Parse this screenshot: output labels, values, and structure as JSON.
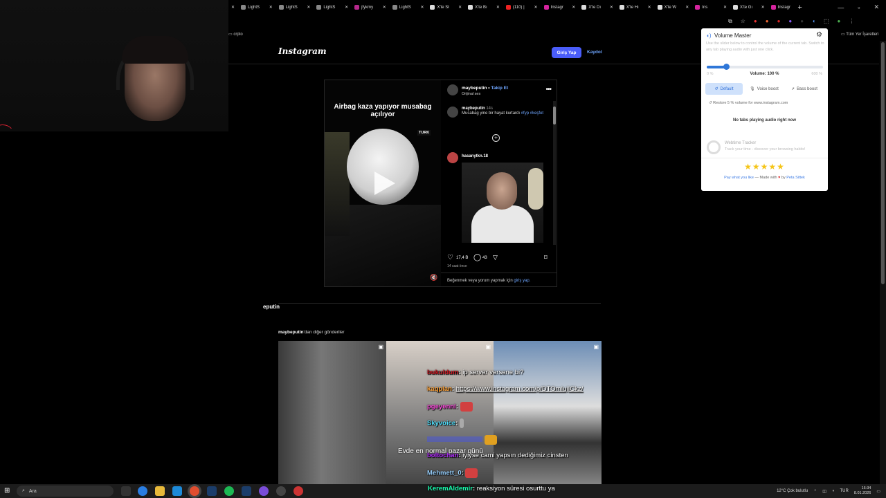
{
  "browser": {
    "tabs": [
      {
        "label": "LightS",
        "color": "#888"
      },
      {
        "label": "LightS",
        "color": "#888"
      },
      {
        "label": "LightS",
        "color": "#888"
      },
      {
        "label": "jfykmy",
        "color": "#b6288c"
      },
      {
        "label": "LightS",
        "color": "#888"
      },
      {
        "label": "X'te Sł",
        "color": "#ddd"
      },
      {
        "label": "X'te Bı",
        "color": "#ddd"
      },
      {
        "label": "(110) |",
        "color": "#e22"
      },
      {
        "label": "Instagr",
        "color": "#d6249f"
      },
      {
        "label": "X'te Dı",
        "color": "#ddd"
      },
      {
        "label": "X'te Hı",
        "color": "#ddd"
      },
      {
        "label": "X'te W",
        "color": "#ddd"
      },
      {
        "label": "Ins",
        "color": "#d6249f"
      },
      {
        "label": "X'te Gı",
        "color": "#ddd"
      },
      {
        "label": "Instagr",
        "color": "#d6249f"
      }
    ],
    "new_tab": "+",
    "bookmark_left": "crpto",
    "bookmark_right": "Tüm Yer İşaretleri"
  },
  "instagram": {
    "logo": "Instagram",
    "login_button": "Giriş Yap",
    "signup_link": "Kaydol",
    "post": {
      "video_caption": "Airbag kaza yapıyor musabag açılıyor",
      "channel_badge": "TURK",
      "author": "maybeputin",
      "follow": "Takip Et",
      "audio": "Orijinal ses",
      "comment1_user": "maybeputin",
      "comment1_time": "14s",
      "comment1_text": "Musabag yine bir hayat kurtardı",
      "comment1_tags": "#fyp #keşfet",
      "comment2_user": "hasanytkn.18",
      "likes": "17,4 B",
      "comments": "43",
      "time_ago": "14 saat önce",
      "login_prompt_pre": "Beğenmek veya yorum yapmak için ",
      "login_prompt_link": "giriş yap."
    },
    "more_posts_user": "maybeputin",
    "more_posts_suffix": "'dan diğer gönderiler",
    "overlay_user": "eputin",
    "overlay_caption": "Evde en normal pazar günü"
  },
  "stream_chat": [
    {
      "user": "bukuldum",
      "msg": "ip server versene bi?"
    },
    {
      "user": "kaqplan",
      "msg": "https://www.instagram.com/p/DTOmIujICkz/"
    },
    {
      "user": "pgeyenni",
      "msg": ""
    },
    {
      "user": "Skyvoice",
      "msg": ""
    },
    {
      "user": "",
      "msg": ""
    },
    {
      "user": "boltochan",
      "msg": "iyiyse cami yapsın dediğimiz cinsten"
    },
    {
      "user": "Mehmett_0",
      "msg": ""
    },
    {
      "user": "KeremAldemir",
      "msg": "reaksiyon süresi osurttu ya"
    }
  ],
  "volume_master": {
    "title": "Volume Master",
    "description": "Use the slider below to control the volume of the current tab. Switch to any tab playing audio with just one click.",
    "slider_min": "0 %",
    "slider_max": "600 %",
    "volume_label": "Volume: 100 %",
    "volume_fraction": 0.1667,
    "modes": [
      "Default",
      "Voice boost",
      "Bass boost"
    ],
    "restore": "Restore 5 % volume for www.instagram.com",
    "no_audio": "No tabs playing audio right now",
    "tracker_title": "Webtime Tracker",
    "tracker_sub": "Track your time - discover your browsing habits!",
    "stars": "★★★★★",
    "footer_pay": "Pay what you like",
    "footer_made": " — Made with ",
    "footer_heart": "♥",
    "footer_by": " by ",
    "footer_author": "Peta Sittek"
  },
  "taskbar": {
    "search_placeholder": "Ara",
    "weather": "12°C  Çok bulutlu",
    "lang": "TUR",
    "time": "16:34",
    "date": "8.01.2026"
  },
  "colors": {
    "instagram_blue": "#4a5df9",
    "link_blue": "#6fa6ff",
    "slider_blue": "#2f77d8",
    "star_gold": "#f5c518"
  }
}
